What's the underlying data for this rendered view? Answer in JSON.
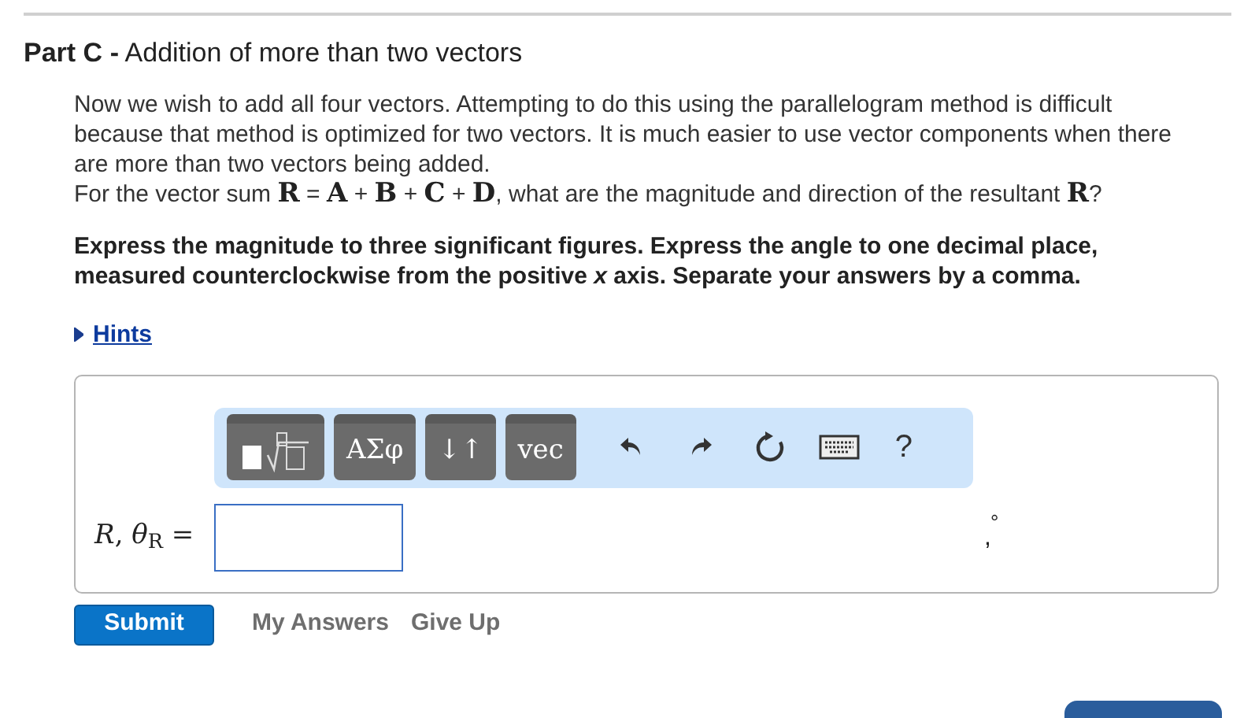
{
  "part": {
    "label": "Part C",
    "separator": "-",
    "title": "Addition of more than two vectors"
  },
  "paragraphs": [
    "Now we wish to add all four vectors. Attempting to do this using the parallelogram method is difficult because that method is optimized for two vectors. It is much easier to use vector components when there are more than two vectors being added.",
    "For the vector sum **R** = **A** + **B** + **C** + **D**, what are the magnitude and direction of the resultant **R**?"
  ],
  "instructions": "Express the magnitude to three significant figures. Express the angle to one decimal place, measured counterclockwise from the positive *x* axis. Separate your answers by a comma.",
  "hints": {
    "label": "Hints",
    "expanded": false
  },
  "toolbar": [
    {
      "kind": "templates"
    },
    {
      "kind": "text",
      "label": "ΑΣφ"
    },
    {
      "kind": "text",
      "label": "↓↑"
    },
    {
      "kind": "text",
      "label": "vec"
    },
    {
      "kind": "undo"
    },
    {
      "kind": "redo"
    },
    {
      "kind": "reset"
    },
    {
      "kind": "keyboard"
    },
    {
      "kind": "plain",
      "label": "?"
    }
  ],
  "answer": {
    "label": "*R*, *θ*$_{R}$ =",
    "units": "°",
    "separator": ","
  },
  "actions": [
    {
      "kind": "primary",
      "label": "Submit"
    },
    {
      "kind": "link",
      "label": "My Answers"
    },
    {
      "kind": "link",
      "label": "Give Up"
    }
  ]
}
